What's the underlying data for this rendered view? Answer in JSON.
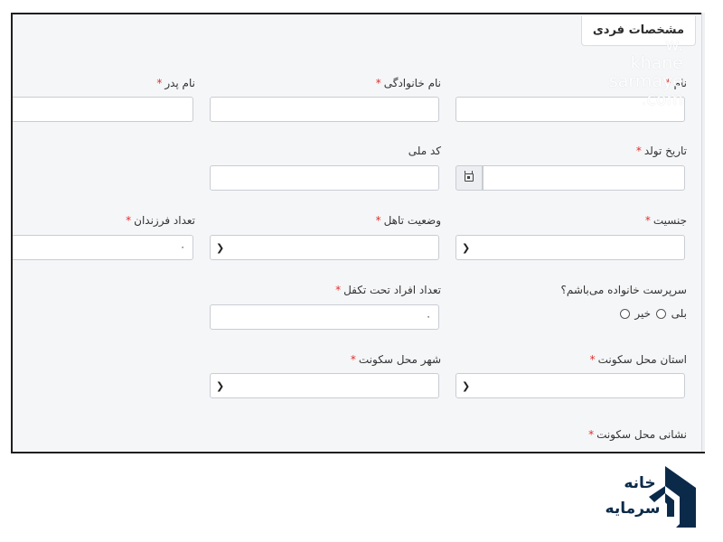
{
  "section": {
    "title": "مشخصات فردی"
  },
  "watermark": {
    "line1": "w.",
    "line2": "khane",
    "line3": "sarmaye",
    "line4": ".com"
  },
  "form": {
    "required_mark": "*",
    "first_name": {
      "label": "نام",
      "value": ""
    },
    "last_name": {
      "label": "نام خانوادگی",
      "value": ""
    },
    "father_name": {
      "label": "نام پدر",
      "value": ""
    },
    "birth_date": {
      "label": "تاریخ تولد",
      "value": ""
    },
    "national_code": {
      "label": "کد ملی",
      "value": ""
    },
    "gender": {
      "label": "جنسیت",
      "value": ""
    },
    "marital_status": {
      "label": "وضعیت تاهل",
      "value": ""
    },
    "children_count": {
      "label": "تعداد فرزندان",
      "value": "۰"
    },
    "head_of_household": {
      "label": "سرپرست خانواده می‌باشم؟",
      "option_yes": "بلی",
      "option_no": "خیر"
    },
    "dependents_count": {
      "label": "تعداد افراد تحت تکفل",
      "value": "۰"
    },
    "province": {
      "label": "استان محل سکونت",
      "value": ""
    },
    "city": {
      "label": "شهر محل سکونت",
      "value": ""
    },
    "address": {
      "label": "نشانی محل سکونت"
    }
  },
  "logo": {
    "text_top": "خانه",
    "text_bottom": "سرمایه",
    "color": "#0b2a4a"
  },
  "colors": {
    "required": "#e0302c",
    "background": "#f5f6f8",
    "border": "#c9ccd2"
  }
}
